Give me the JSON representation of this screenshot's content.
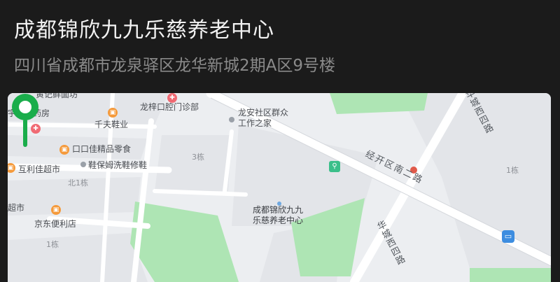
{
  "header": {
    "title": "成都锦欣九九乐慈养老中心",
    "address": "四川省成都市龙泉驿区龙华新城2期A区9号楼"
  },
  "map": {
    "labels": {
      "shop_top": "黄记鲜面坊",
      "yucheng_pharmacy": "宇诚大药房",
      "qianfu_shoes": "千夫鞋业",
      "longzi_dental": "龙梓口腔门诊部",
      "longan_community": "龙安社区群众\n工作之家",
      "kouqu_store": "口口佳精品零食",
      "shoe_care": "鞋保姆洗鞋修鞋",
      "hulijia": "互利佳超市",
      "b3": "3栋",
      "b_north1": "北1栋",
      "supermarket": "超市",
      "jd_store": "京东便利店",
      "b1_left": "1栋",
      "b1_right": "1栋",
      "target_name": "成都锦欣九九\n乐慈养老中心",
      "jingkai_road": "经开区南二路",
      "huacheng_west_top": "华城西四路",
      "huacheng_west_bottom": "华城西四路"
    },
    "icons": {
      "pin": "location-pin-icon",
      "restroom": "restroom-icon",
      "bus": "bus-stop-icon"
    },
    "colors": {
      "pin": "#1aad4b",
      "green_area": "#a6e3b0",
      "road": "#ffffff",
      "block": "#e2e4e8"
    }
  }
}
